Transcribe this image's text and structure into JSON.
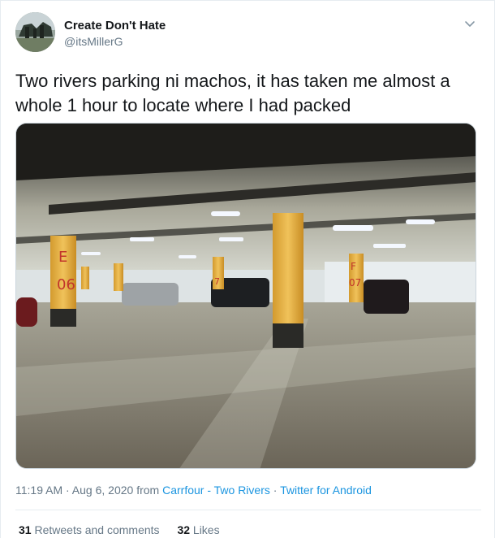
{
  "author": {
    "display_name": "Create Don't Hate",
    "handle": "@itsMillerG"
  },
  "tweet": {
    "text": "Two rivers parking ni machos, it has taken me almost a whole 1 hour to locate where I had packed"
  },
  "photo": {
    "pillar_labels": [
      "E 06",
      "F 07",
      "7"
    ]
  },
  "meta": {
    "time": "11:19 AM",
    "dot1": " · ",
    "date": "Aug 6, 2020",
    "from": " from ",
    "place": "Carrfour - Two Rivers",
    "dot2": " · ",
    "source": "Twitter for Android"
  },
  "stats": {
    "retweets_count": "31",
    "retweets_label": "Retweets and comments",
    "likes_count": "32",
    "likes_label": "Likes"
  },
  "colors": {
    "link": "#1b95e0",
    "muted": "#657786",
    "text": "#14171a"
  },
  "icons": [
    "chevron-down-icon"
  ]
}
